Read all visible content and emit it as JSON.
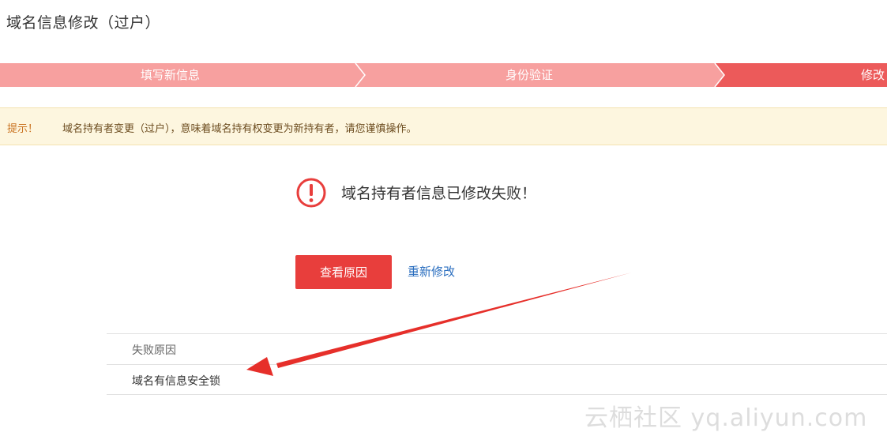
{
  "page": {
    "title": "域名信息修改（过户）"
  },
  "steps": [
    {
      "label": "填写新信息"
    },
    {
      "label": "身份验证"
    },
    {
      "label": "修改"
    }
  ],
  "notice": {
    "label": "提示！",
    "text": "域名持有者变更（过户），意味着域名持有权变更为新持有者，请您谨慎操作。"
  },
  "result": {
    "message": "域名持有者信息已修改失败！",
    "view_reason_label": "查看原因",
    "retry_label": "重新修改"
  },
  "reason_table": {
    "header": "失败原因",
    "value": "域名有信息安全锁"
  },
  "watermark": {
    "text": "云栖社区 yq.aliyun.com"
  },
  "colors": {
    "step_pending": "#f7a09f",
    "step_active": "#ec5a5a",
    "button_red": "#e83e3c",
    "link_blue": "#2a6ebf",
    "notice_bg": "#fdf6df",
    "arrow_red": "#e62f2a"
  }
}
